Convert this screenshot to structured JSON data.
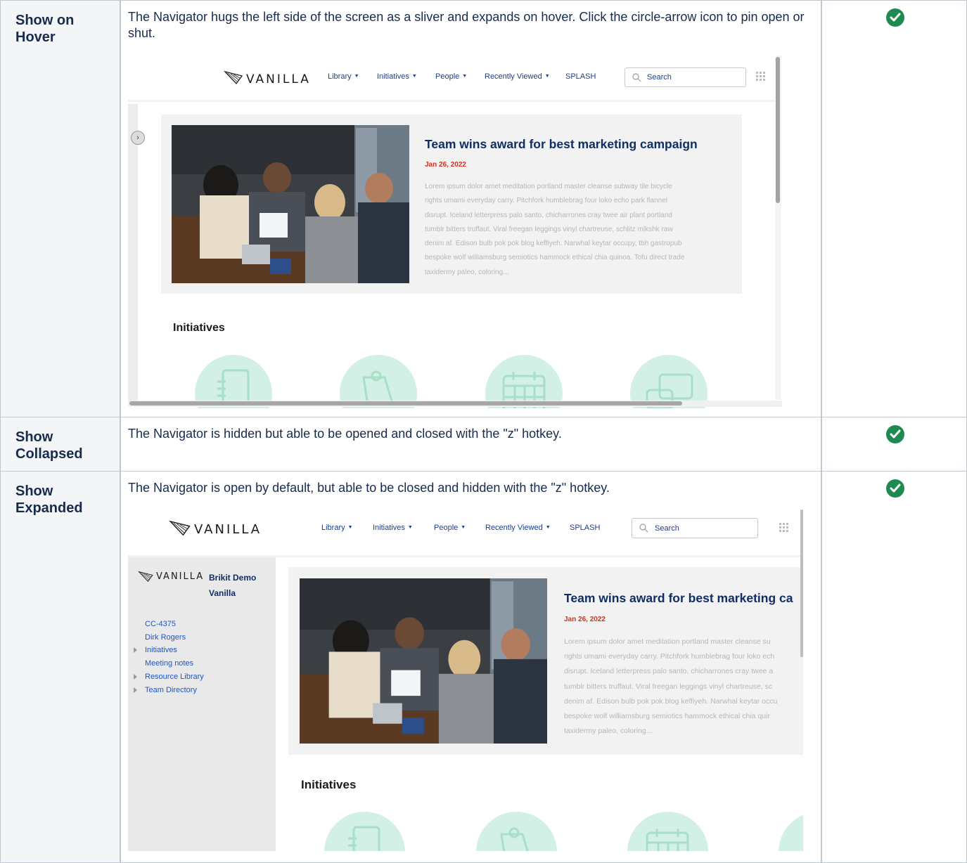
{
  "rows": [
    {
      "title_line1": "Show on",
      "title_line2": "Hover",
      "description": "The Navigator hugs the left side of the screen as a sliver and expands on hover. Click the circle-arrow icon to pin open or shut.",
      "status": "check"
    },
    {
      "title_line1": "Show",
      "title_line2": "Collapsed",
      "description": "The Navigator is hidden but able to be opened and closed with the \"z\" hotkey.",
      "status": "check"
    },
    {
      "title_line1": "Show",
      "title_line2": "Expanded",
      "description": "The Navigator is open by default, but able to be closed and hidden with the \"z\" hotkey.",
      "status": "check"
    }
  ],
  "screenshot": {
    "logo": "VANILLA",
    "nav": {
      "library": "Library",
      "initiatives": "Initiatives",
      "people": "People",
      "recently_viewed": "Recently Viewed",
      "splash": "SPLASH"
    },
    "search_placeholder": "Search",
    "feature_title": "Team wins award for best marketing campaign",
    "feature_title_clipped": "Team wins award for best marketing ca",
    "feature_date": "Jan 26, 2022",
    "feature_lines": [
      "Lorem ipsum dolor amet meditation portland master cleanse subway tile bicycle",
      "rights umami everyday carry. Pitchfork humblebrag four loko echo park flannel",
      "disrupt. Iceland letterpress palo santo, chicharrones cray twee air plant portland",
      "tumblr bitters truffaut. Viral freegan leggings vinyl chartreuse, schlitz mlkshk raw",
      "denim af. Edison bulb pok pok blog keffiyeh. Narwhal keytar occupy, tbh gastropub",
      "bespoke wolf williamsburg semiotics hammock ethical chia quinoa. Tofu direct trade",
      "taxidermy paleo, coloring..."
    ],
    "feature_lines_clipped": [
      "Lorem ipsum dolor amet meditation portland master cleanse su",
      "rights umami everyday carry. Pitchfork humblebrag four loko ech",
      "disrupt. Iceland letterpress palo santo, chicharrones cray twee a",
      "tumblr bitters truffaut. Viral freegan leggings vinyl chartreuse, sc",
      "denim af. Edison bulb pok pok blog keffiyeh. Narwhal keytar occu",
      "bespoke wolf williamsburg semiotics hammock ethical chia quir",
      "taxidermy paleo, coloring..."
    ],
    "initiatives_heading": "Initiatives",
    "sidebar": {
      "logo": "VANILLA",
      "space_name_line1": "Brikit Demo",
      "space_name_line2": "Vanilla",
      "items": [
        {
          "label": "CC-4375",
          "expandable": false
        },
        {
          "label": "Dirk Rogers",
          "expandable": false
        },
        {
          "label": "Initiatives",
          "expandable": true
        },
        {
          "label": "Meeting notes",
          "expandable": false
        },
        {
          "label": "Resource Library",
          "expandable": true
        },
        {
          "label": "Team Directory",
          "expandable": true
        }
      ]
    }
  },
  "colors": {
    "check": "#1e8a51",
    "nav_link": "#1d3f87",
    "feature_title": "#0f2e64",
    "feature_date": "#d0321e",
    "initiative_circle": "#d2f0e6",
    "sidebar_link": "#1d56c9"
  }
}
